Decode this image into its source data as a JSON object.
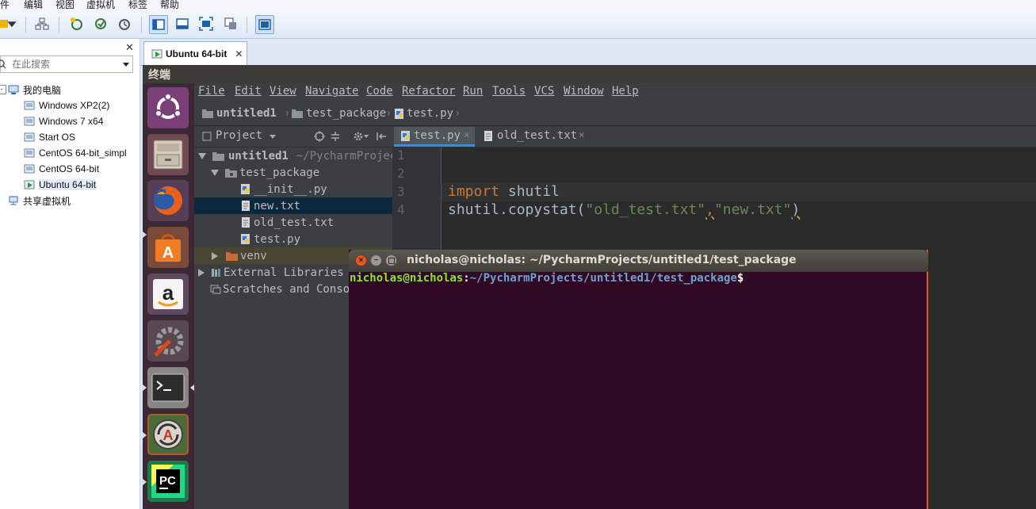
{
  "vmware": {
    "menu": [
      "件",
      "编辑",
      "视图",
      "虚拟机",
      "标签",
      "帮助"
    ],
    "library": {
      "search_placeholder": "在此搜索",
      "tree": [
        {
          "label": "我的电脑",
          "icon": "computer-icon"
        },
        {
          "label": "Windows XP2(2)",
          "icon": "vm-icon"
        },
        {
          "label": "Windows 7 x64",
          "icon": "vm-icon"
        },
        {
          "label": "Start OS",
          "icon": "vm-icon"
        },
        {
          "label": "CentOS 64-bit_simpl",
          "icon": "vm-icon"
        },
        {
          "label": "CentOS 64-bit",
          "icon": "vm-icon"
        },
        {
          "label": "Ubuntu 64-bit",
          "icon": "vm-running-icon",
          "selected": true
        },
        {
          "label": "共享虚拟机",
          "icon": "shared-vm-icon"
        }
      ],
      "close_glyph": "✕"
    },
    "tab": {
      "label": "Ubuntu 64-bit",
      "close_glyph": "✕"
    }
  },
  "ubuntu": {
    "panel_title": "终端",
    "launcher": [
      "ubuntu-dash-icon",
      "files-icon",
      "firefox-icon",
      "software-center-icon",
      "amazon-icon",
      "system-settings-icon",
      "terminal-icon",
      "software-updater-icon",
      "pycharm-icon"
    ]
  },
  "pycharm": {
    "menu": [
      "File",
      "Edit",
      "View",
      "Navigate",
      "Code",
      "Refactor",
      "Run",
      "Tools",
      "VCS",
      "Window",
      "Help"
    ],
    "breadcrumb": [
      "untitled1",
      "test_package",
      "test.py"
    ],
    "project_header": "Project",
    "tree": [
      {
        "label": "untitled1",
        "suffix": "~/PycharmProjec",
        "kind": "folder-open",
        "indent": 0
      },
      {
        "label": "test_package",
        "kind": "folder-open",
        "indent": 1
      },
      {
        "label": "__init__.py",
        "kind": "py",
        "indent": 2
      },
      {
        "label": "new.txt",
        "kind": "txt",
        "indent": 2,
        "selected": true
      },
      {
        "label": "old_test.txt",
        "kind": "txt",
        "indent": 2
      },
      {
        "label": "test.py",
        "kind": "py",
        "indent": 2
      },
      {
        "label": "venv",
        "kind": "folder-closed",
        "indent": 1
      },
      {
        "label": "External Libraries",
        "kind": "lib",
        "indent": 0
      },
      {
        "label": "Scratches and Consol",
        "kind": "scratch",
        "indent": 0
      }
    ],
    "editor_tabs": [
      {
        "label": "test.py",
        "active": true
      },
      {
        "label": "old_test.txt",
        "active": false
      }
    ],
    "line_numbers": [
      "1",
      "2",
      "3",
      "4"
    ],
    "code": {
      "line3_kw": "import",
      "line3_rest": " shutil",
      "line4_a": "shutil.copystat(",
      "line4_s1": "\"old_test.txt\"",
      "line4_comma": ",",
      "line4_s2": "\"new.txt\"",
      "line4_end": ")"
    }
  },
  "terminal": {
    "title": "nicholas@nicholas: ~/PycharmProjects/untitled1/test_package",
    "prompt_user": "nicholas@nicholas",
    "prompt_colon": ":",
    "prompt_path": "~/PycharmProjects/untitled1/test_package",
    "prompt_end": "$"
  }
}
